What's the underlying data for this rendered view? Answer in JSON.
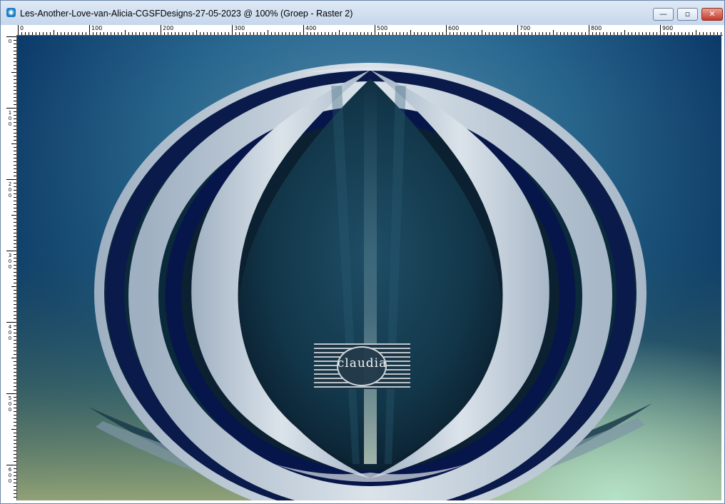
{
  "window": {
    "title": "Les-Another-Love-van-Alicia-CGSFDesigns-27-05-2023 @ 100% (Groep - Raster 2)",
    "app_icon_glyph": "◉"
  },
  "controls": {
    "minimize": "—",
    "restore": "▫",
    "close": "✕"
  },
  "rulers": {
    "horizontal_labels": [
      "0",
      "100",
      "200",
      "300",
      "400",
      "500",
      "600",
      "700",
      "800",
      "900"
    ],
    "vertical_labels": [
      "0",
      "100",
      "200",
      "300",
      "400",
      "500",
      "600"
    ]
  },
  "watermark": {
    "text": "claudia"
  },
  "colors": {
    "titlebar_top": "#dfe9f5",
    "titlebar_bottom": "#c6d7ec",
    "close_button": "#c6392a",
    "canvas_deep_blue": "#06234a",
    "canvas_teal": "#1a4a5e",
    "canvas_olive": "#8fa56f",
    "canvas_mint": "#a8dcc2",
    "ribbon_silver": "#c8d3dc"
  }
}
